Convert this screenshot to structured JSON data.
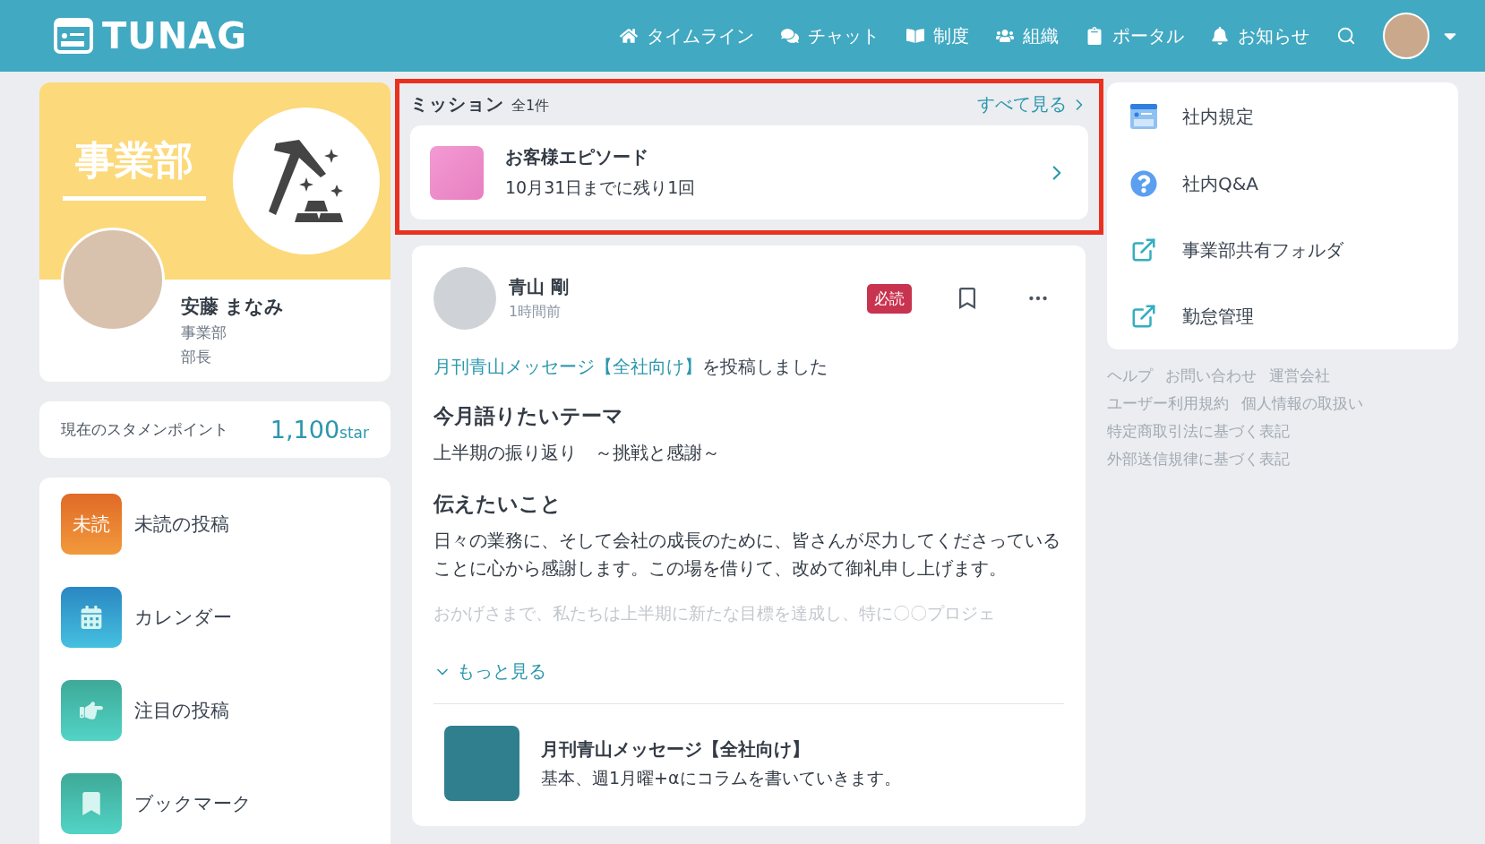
{
  "header": {
    "logo": "TUNAG",
    "nav": [
      {
        "label": "タイムライン"
      },
      {
        "label": "チャット"
      },
      {
        "label": "制度"
      },
      {
        "label": "組織"
      },
      {
        "label": "ポータル"
      },
      {
        "label": "お知らせ"
      }
    ]
  },
  "profile": {
    "banner_title": "事業部",
    "name": "安藤 まなみ",
    "department": "事業部",
    "position": "部長"
  },
  "points": {
    "label": "現在のスタメンポイント",
    "value": "1,100",
    "unit": "star"
  },
  "menu": [
    {
      "label": "未読の投稿",
      "icon_text": "未読"
    },
    {
      "label": "カレンダー"
    },
    {
      "label": "注目の投稿"
    },
    {
      "label": "ブックマーク"
    }
  ],
  "missions": {
    "title": "ミッション",
    "count": "全1件",
    "see_all": "すべて見る",
    "items": [
      {
        "title": "お客様エピソード",
        "subtitle": "10月31日までに残り1回"
      }
    ]
  },
  "post": {
    "author": "青山 剛",
    "time": "1時間前",
    "badge": "必読",
    "activity_link": "月刊青山メッセージ【全社向け】",
    "activity_text": "を投稿しました",
    "sections": [
      {
        "heading": "今月語りたいテーマ",
        "body": "上半期の振り返り　～挑戦と感謝～"
      },
      {
        "heading": "伝えたいこと",
        "body": "日々の業務に、そして会社の成長のために、皆さんが尽力してくださっていることに心から感謝します。この場を借りて、改めて御礼申し上げます。"
      }
    ],
    "faded_text": "おかげさまで、私たちは上半期に新たな目標を達成し、特に〇〇プロジェ",
    "more": "もっと見る",
    "channel": {
      "title": "月刊青山メッセージ【全社向け】",
      "description": "基本、週1月曜+αにコラムを書いていきます。"
    }
  },
  "links": [
    {
      "label": "社内規定"
    },
    {
      "label": "社内Q&A"
    },
    {
      "label": "事業部共有フォルダ"
    },
    {
      "label": "勤怠管理"
    }
  ],
  "footer_links": [
    [
      "ヘルプ",
      "お問い合わせ",
      "運営会社"
    ],
    [
      "ユーザー利用規約",
      "個人情報の取扱い"
    ],
    [
      "特定商取引法に基づく表記"
    ],
    [
      "外部送信規律に基づく表記"
    ]
  ]
}
